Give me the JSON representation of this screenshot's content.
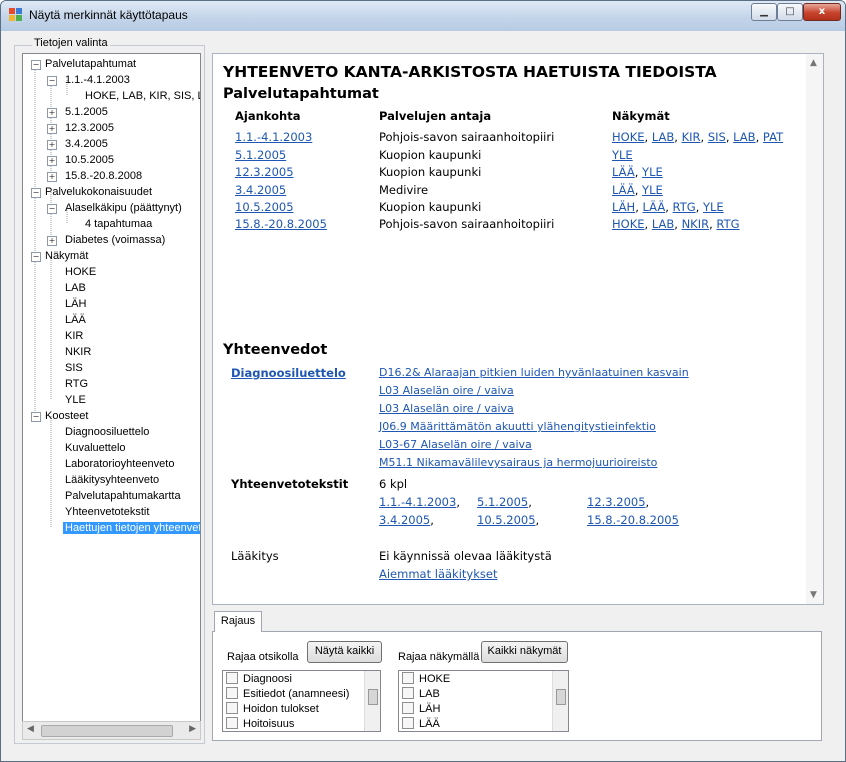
{
  "window": {
    "title": "Näytä merkinnät käyttötapaus",
    "min_label": "▁",
    "max_label": "□",
    "close_label": "x"
  },
  "left": {
    "group_label": "Tietojen valinta",
    "tree": [
      "Palvelutapahtumat",
      "1.1.-4.1.2003",
      "HOKE, LAB, KIR, SIS, L",
      "5.1.2005",
      "12.3.2005",
      "3.4.2005",
      "10.5.2005",
      "15.8.-20.8.2008",
      "Palvelukokonaisuudet",
      "Alaselkäkipu (päättynyt)",
      "4 tapahtumaa",
      "Diabetes (voimassa)",
      "Näkymät",
      "HOKE",
      "LAB",
      "LÄH",
      "LÄÄ",
      "KIR",
      "NKIR",
      "SIS",
      "RTG",
      "YLE",
      "Koosteet",
      "Diagnoosiluettelo",
      "Kuvaluettelo",
      "Laboratorioyhteenveto",
      "Lääkitysyhteenveto",
      "Palvelutapahtumakartta",
      "Yhteenvetotekstit",
      "Haettujen tietojen yhteenveto"
    ]
  },
  "main": {
    "title": "YHTEENVETO KANTA-ARKISTOSTA HAETUISTA TIEDOISTA",
    "section1": "Palvelutapahtumat",
    "headers": [
      "Ajankohta",
      "Palvelujen antaja",
      "Näkymät"
    ],
    "rows": [
      {
        "date": "1.1.-4.1.2003",
        "provider": "Pohjois-savon sairaanhoitopiiri",
        "views": [
          "HOKE",
          "LAB",
          "KIR",
          "SIS",
          "LAB",
          "PAT"
        ]
      },
      {
        "date": "5.1.2005",
        "provider": "Kuopion kaupunki",
        "views": [
          "YLE"
        ]
      },
      {
        "date": "12.3.2005",
        "provider": "Kuopion kaupunki",
        "views": [
          "LÄÄ",
          "YLE"
        ]
      },
      {
        "date": "3.4.2005",
        "provider": "Medivire",
        "views": [
          "LÄÄ",
          "YLE"
        ]
      },
      {
        "date": "10.5.2005",
        "provider": "Kuopion kaupunki",
        "views": [
          "LÄH",
          "LÄÄ",
          "RTG",
          "YLE"
        ]
      },
      {
        "date": "15.8.-20.8.2005",
        "provider": "Pohjois-savon sairaanhoitopiiri",
        "views": [
          "HOKE",
          "LAB",
          "NKIR",
          "RTG"
        ]
      }
    ],
    "section2": "Yhteenvedot",
    "diag_label": "Diagnoosiluettelo",
    "diagnoses": [
      "D16.2& Alaraajan pitkien luiden hyvänlaatuinen kasvain",
      "L03 Alaselän oire / vaiva",
      "L03 Alaselän oire / vaiva",
      "J06.9 Määrittämätön akuutti ylähengitystieinfektio",
      "L03-67 Alaselän oire / vaiva",
      "M51.1 Nikamavälilevysairaus ja hermojuurioireisto"
    ],
    "texts_label": "Yhteenvetotekstit",
    "texts_count": "6 kpl",
    "text_links": [
      "1.1.-4.1.2003",
      "5.1.2005",
      "12.3.2005",
      "3.4.2005",
      "10.5.2005",
      "15.8.-20.8.2005"
    ],
    "med_label": "Lääkitys",
    "med_status": "Ei käynnissä olevaa lääkitystä",
    "med_link": "Aiemmat lääkitykset"
  },
  "filter": {
    "tab": "Rajaus",
    "by_heading": "Rajaa otsikolla",
    "show_all": "Näytä kaikki",
    "by_view": "Rajaa näkymällä",
    "all_views": "Kaikki näkymät",
    "headings": [
      "Diagnoosi",
      "Esitiedot (anamneesi)",
      "Hoidon tulokset",
      "Hoitoisuus"
    ],
    "views": [
      "HOKE",
      "LAB",
      "LÄH",
      "LÄÄ"
    ]
  }
}
